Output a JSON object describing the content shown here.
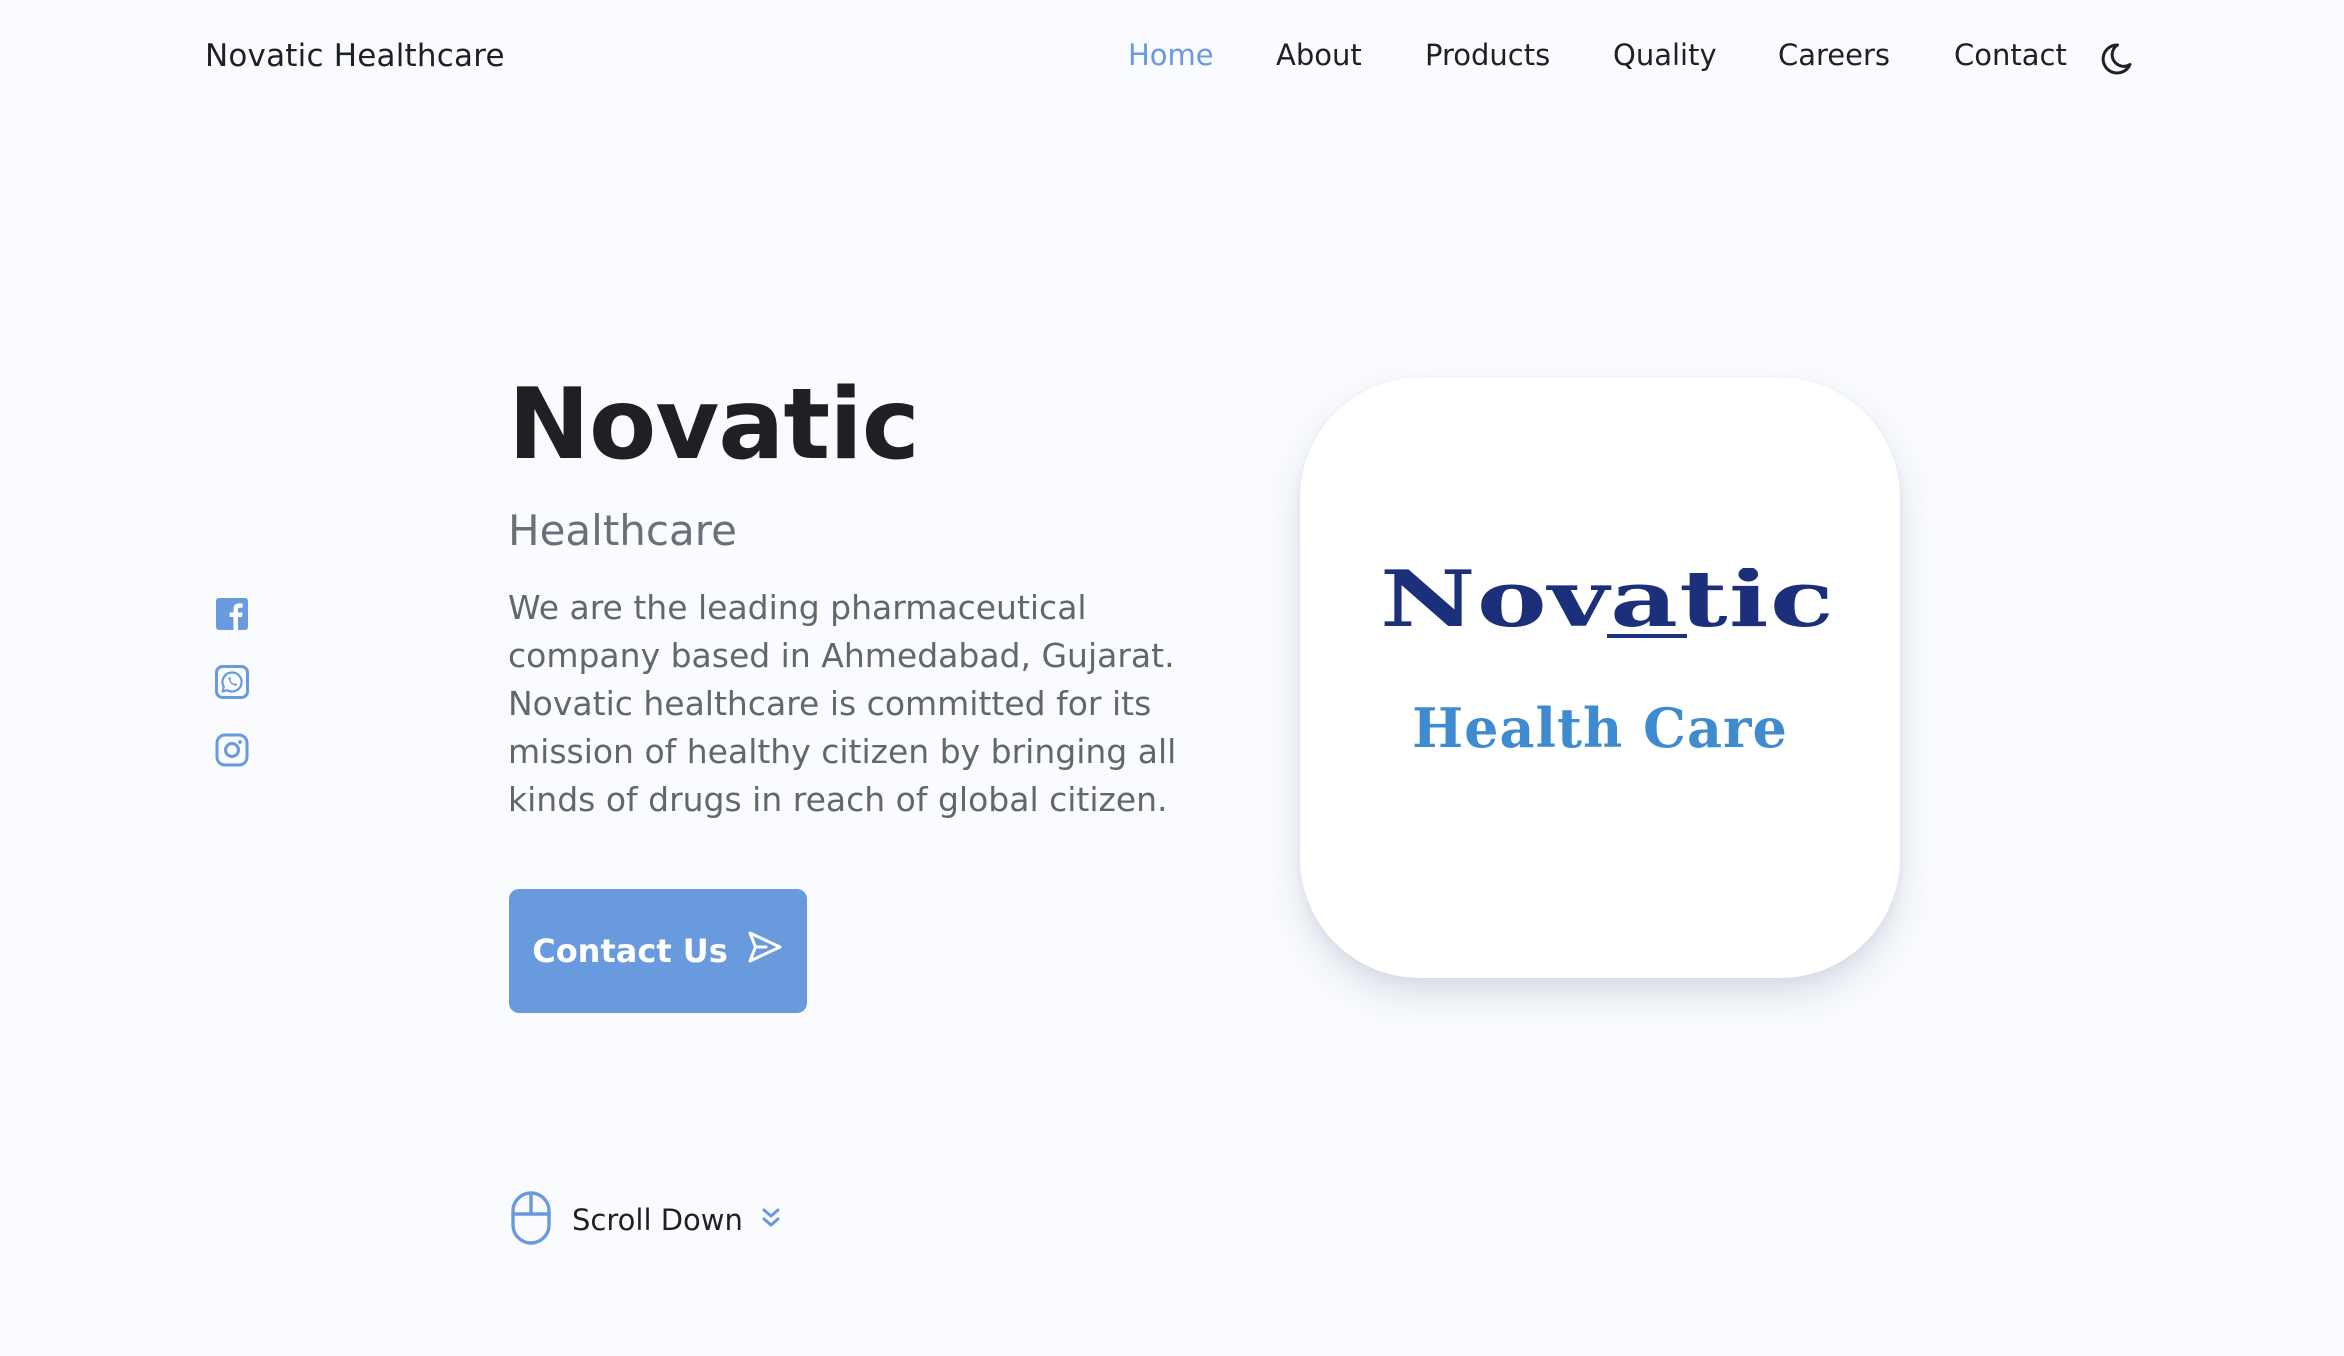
{
  "header": {
    "brand": "Novatic Healthcare",
    "nav": [
      {
        "label": "Home",
        "active": true
      },
      {
        "label": "About",
        "active": false
      },
      {
        "label": "Products",
        "active": false
      },
      {
        "label": "Quality",
        "active": false
      },
      {
        "label": "Careers",
        "active": false
      },
      {
        "label": "Contact",
        "active": false
      }
    ],
    "theme_toggle_icon": "moon-icon"
  },
  "social": [
    {
      "name": "facebook",
      "icon": "facebook-icon"
    },
    {
      "name": "whatsapp",
      "icon": "whatsapp-icon"
    },
    {
      "name": "instagram",
      "icon": "instagram-icon"
    }
  ],
  "hero": {
    "title": "Novatic",
    "subtitle": "Healthcare",
    "description": "We are the leading pharmaceutical company based in Ahmedabad, Gujarat. Novatic healthcare is committed for its mission of healthy citizen by bringing all kinds of drugs in reach of global citizen.",
    "cta_label": "Contact Us",
    "cta_icon": "send-icon"
  },
  "logo": {
    "wordmark": "Novatic",
    "tagline": "Health Care"
  },
  "scroll": {
    "label": "Scroll Down",
    "icon": "mouse-icon",
    "chevron_icon": "chevrons-down-icon"
  },
  "colors": {
    "accent": "#6a9ade",
    "background": "#f9fbfe",
    "text": "#1f2024",
    "muted": "#6b6f78",
    "logo_navy": "#1c2f7a",
    "logo_blue": "#3f8bd0"
  }
}
